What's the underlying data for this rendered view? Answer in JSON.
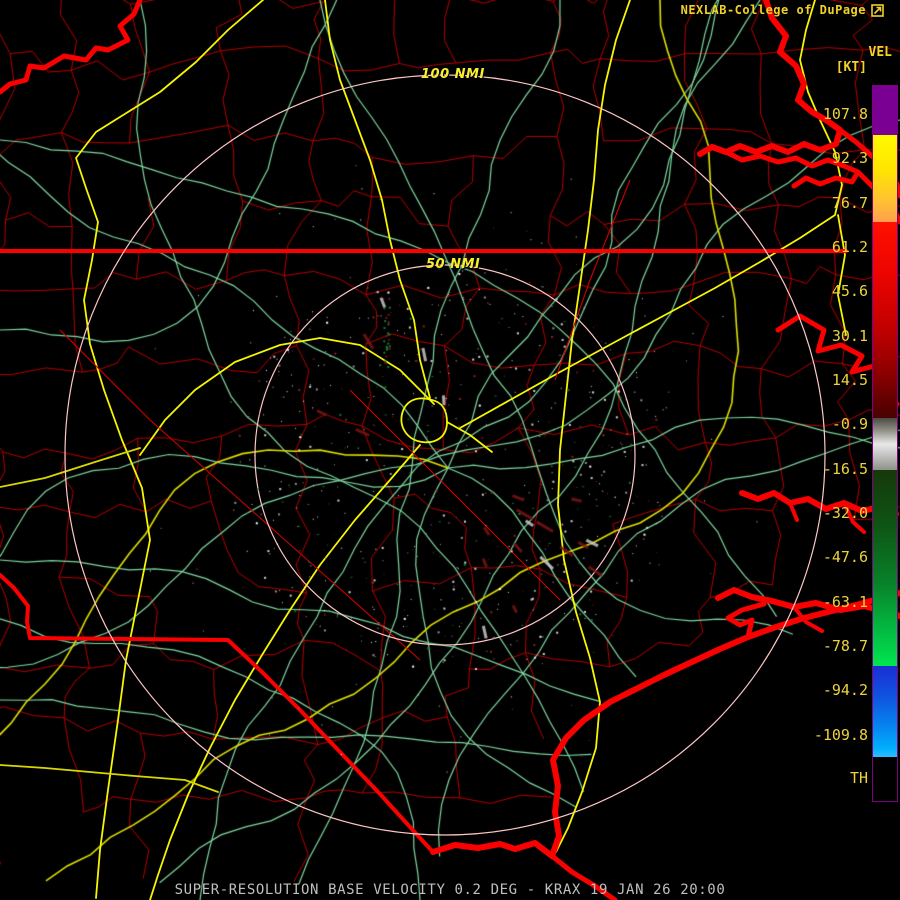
{
  "header": {
    "brand": "NEXLAB-College of DuPage",
    "logo_icon": "external-link-icon"
  },
  "scale": {
    "title": "VEL",
    "units": "[KT]",
    "bottom_label": "TH",
    "ticks": [
      "107.8",
      "92.3",
      "76.7",
      "61.2",
      "45.6",
      "30.1",
      "14.5",
      "-0.9",
      "-16.5",
      "-32.0",
      "-47.6",
      "-63.1",
      "-78.7",
      "-94.2",
      "-109.8"
    ],
    "colors": {
      "range_folded_purple": "#7a0094",
      "inbound_max_yellow": "#fffa00",
      "inbound_orange": "#ff9e4e",
      "inbound_red": "#c00000",
      "zero_gray": "#e8e8e8",
      "outbound_green": "#00e64e",
      "outbound_blue": "#00aefc"
    }
  },
  "map": {
    "rings": [
      {
        "label": "100 NMI"
      },
      {
        "label": "50 NMI"
      }
    ],
    "colors": {
      "background": "#000000",
      "county_boundary": "#c00000",
      "state_border_water": "#ff0000",
      "road_secondary": "#7fd8a0",
      "road_primary": "#f6f600",
      "range_ring": "#ffc6c6"
    }
  },
  "footer": {
    "product_title": "SUPER-RESOLUTION BASE VELOCITY 0.2 DEG - KRAX 19 JAN 26 20:00"
  }
}
